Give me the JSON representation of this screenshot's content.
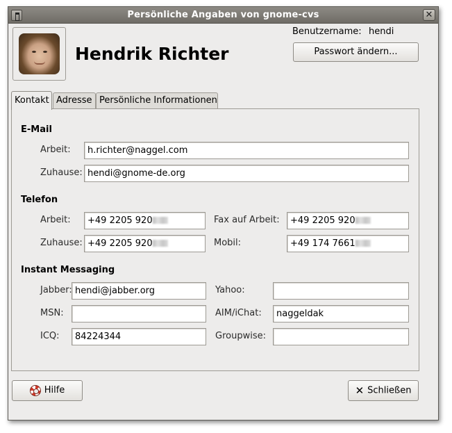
{
  "window": {
    "title": "Persönliche Angaben von gnome-cvs",
    "close_glyph": "✕"
  },
  "header": {
    "full_name": "Hendrik Richter",
    "username_label": "Benutzername:",
    "username_value": "hendi",
    "change_password_label": "Passwort ändern..."
  },
  "tabs": [
    {
      "label": "Kontakt",
      "active": true
    },
    {
      "label": "Adresse",
      "active": false
    },
    {
      "label": "Persönliche Informationen",
      "active": false
    }
  ],
  "email": {
    "section": "E-Mail",
    "work_label": "Arbeit:",
    "work_value": "h.richter@naggel.com",
    "home_label": "Zuhause:",
    "home_value": "hendi@gnome-de.org"
  },
  "phone": {
    "section": "Telefon",
    "work_label": "Arbeit:",
    "work_value": "+49 2205 920",
    "home_label": "Zuhause:",
    "home_value": "+49 2205 920",
    "fax_label": "Fax auf Arbeit:",
    "fax_value": "+49 2205 920",
    "mobile_label": "Mobil:",
    "mobile_value": "+49 174 7661"
  },
  "im": {
    "section": "Instant Messaging",
    "jabber_label": "Jabber:",
    "jabber_value": "hendi@jabber.org",
    "msn_label": "MSN:",
    "msn_value": "",
    "icq_label": "ICQ:",
    "icq_value": "84224344",
    "yahoo_label": "Yahoo:",
    "yahoo_value": "",
    "aim_label": "AIM/iChat:",
    "aim_value": "naggeldak",
    "groupwise_label": "Groupwise:",
    "groupwise_value": ""
  },
  "footer": {
    "help_label": "Hilfe",
    "close_label": "Schließen"
  },
  "icons": {
    "help": "lifebuoy-icon",
    "close": "close-icon",
    "window_menu": "window-menu-icon"
  }
}
